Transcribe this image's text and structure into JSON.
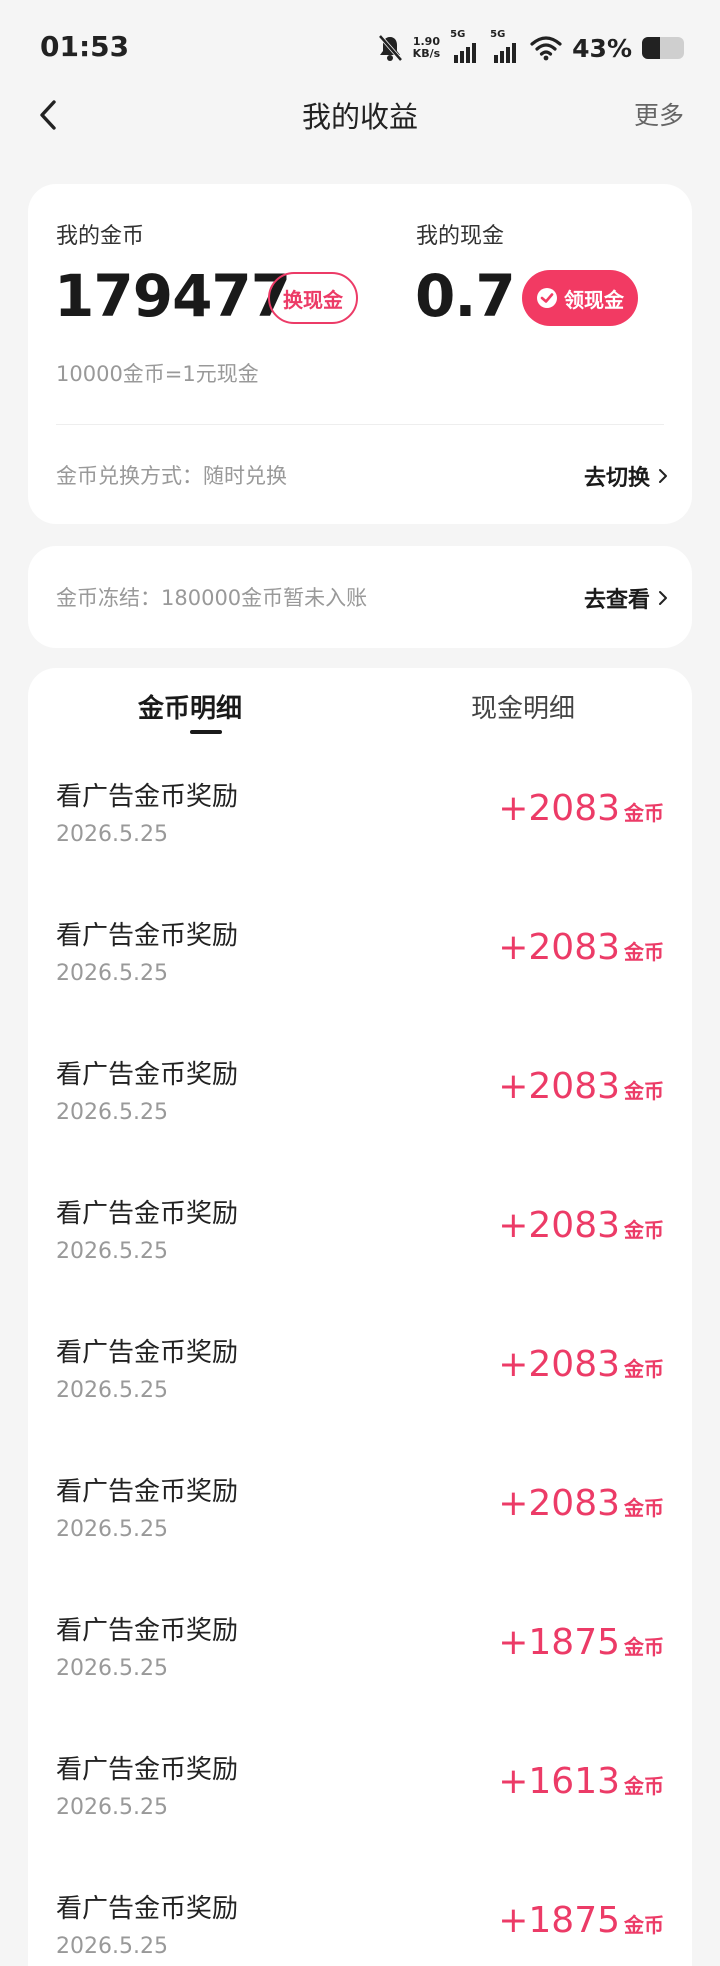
{
  "status_bar": {
    "time": "01:53",
    "speed_value": "1.90",
    "speed_unit": "KB/s",
    "signal1_label": "5G",
    "signal2_label": "5G",
    "battery_percent": "43%",
    "battery_level": 0.43
  },
  "nav": {
    "title": "我的收益",
    "more_label": "更多"
  },
  "summary": {
    "coins_label": "我的金币",
    "coins_value": "179477",
    "exchange_btn": "换现金",
    "cash_label": "我的现金",
    "cash_value": "0.7",
    "claim_btn": "领现金",
    "rate_text": "10000金币=1元现金",
    "method_text": "金币兑换方式：随时兑换",
    "switch_link": "去切换"
  },
  "frozen": {
    "text": "金币冻结：180000金币暂未入账",
    "view_link": "去查看"
  },
  "tabs": [
    {
      "label": "金币明细",
      "active": true
    },
    {
      "label": "现金明细",
      "active": false
    }
  ],
  "records": [
    {
      "title": "看广告金币奖励",
      "date": "2026.5.25",
      "amount": "+2083",
      "unit": "金币"
    },
    {
      "title": "看广告金币奖励",
      "date": "2026.5.25",
      "amount": "+2083",
      "unit": "金币"
    },
    {
      "title": "看广告金币奖励",
      "date": "2026.5.25",
      "amount": "+2083",
      "unit": "金币"
    },
    {
      "title": "看广告金币奖励",
      "date": "2026.5.25",
      "amount": "+2083",
      "unit": "金币"
    },
    {
      "title": "看广告金币奖励",
      "date": "2026.5.25",
      "amount": "+2083",
      "unit": "金币"
    },
    {
      "title": "看广告金币奖励",
      "date": "2026.5.25",
      "amount": "+2083",
      "unit": "金币"
    },
    {
      "title": "看广告金币奖励",
      "date": "2026.5.25",
      "amount": "+1875",
      "unit": "金币"
    },
    {
      "title": "看广告金币奖励",
      "date": "2026.5.25",
      "amount": "+1613",
      "unit": "金币"
    },
    {
      "title": "看广告金币奖励",
      "date": "2026.5.25",
      "amount": "+1875",
      "unit": "金币"
    }
  ],
  "colors": {
    "accent": "#ec3b67",
    "accent_fill": "#f23a63",
    "background": "#f5f5f5"
  }
}
